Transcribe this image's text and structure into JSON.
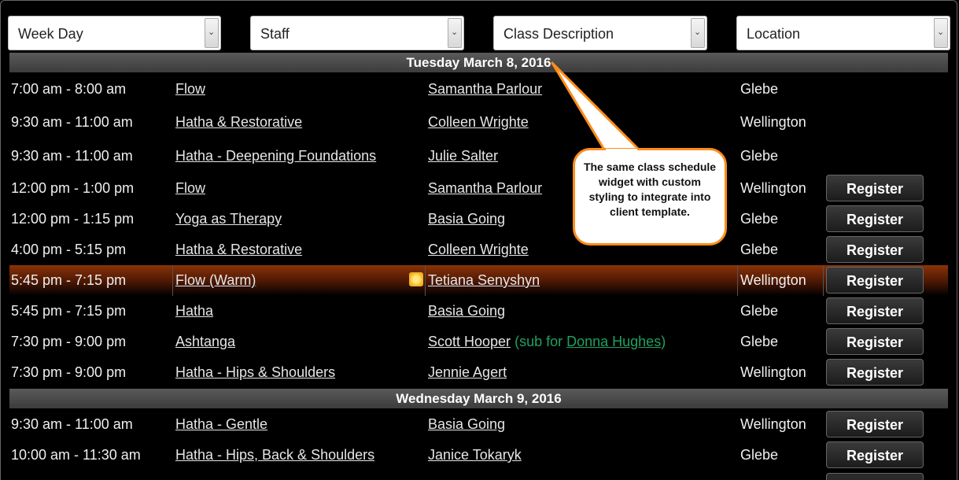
{
  "filters": {
    "weekday": "Week Day",
    "staff": "Staff",
    "class_description": "Class Description",
    "location": "Location"
  },
  "days": [
    {
      "header": "Tuesday March 8, 2016",
      "rows": [
        {
          "time": "7:00 am - 8:00 am",
          "class": "Flow",
          "instructor": "Samantha Parlour",
          "location": "Glebe",
          "register": ""
        },
        {
          "time": "9:30 am - 11:00 am",
          "class": "Hatha & Restorative",
          "instructor": "Colleen Wrighte",
          "location": "Wellington",
          "register": ""
        },
        {
          "time": "9:30 am - 11:00 am",
          "class": "Hatha - Deepening Foundations",
          "instructor": "Julie Salter",
          "location": "Glebe",
          "register": ""
        },
        {
          "time": "12:00 pm - 1:00 pm",
          "class": "Flow",
          "instructor": "Samantha Parlour",
          "location": "Wellington",
          "register": "Register"
        },
        {
          "time": "12:00 pm - 1:15 pm",
          "class": "Yoga as Therapy",
          "instructor": "Basia Going",
          "location": "Glebe",
          "register": "Register"
        },
        {
          "time": "4:00 pm - 5:15 pm",
          "class": "Hatha & Restorative",
          "instructor": "Colleen Wrighte",
          "location": "Glebe",
          "register": "Register"
        },
        {
          "time": "5:45 pm - 7:15 pm",
          "class": "Flow (Warm)",
          "instructor": "Tetiana Senyshyn",
          "location": "Wellington",
          "register": "Register",
          "highlight": true
        },
        {
          "time": "5:45 pm - 7:15 pm",
          "class": "Hatha",
          "instructor": "Basia Going",
          "location": "Glebe",
          "register": "Register"
        },
        {
          "time": "7:30 pm - 9:00 pm",
          "class": "Ashtanga",
          "instructor": "Scott Hooper",
          "sub_prefix": "(sub for ",
          "sub_name": "Donna Hughes",
          "sub_suffix": ")",
          "location": "Glebe",
          "register": "Register"
        },
        {
          "time": "7:30 pm - 9:00 pm",
          "class": "Hatha - Hips & Shoulders",
          "instructor": "Jennie Agert",
          "location": "Wellington",
          "register": "Register"
        }
      ]
    },
    {
      "header": "Wednesday March 9, 2016",
      "rows": [
        {
          "time": "9:30 am - 11:00 am",
          "class": "Hatha - Gentle",
          "instructor": "Basia Going",
          "location": "Wellington",
          "register": "Register"
        },
        {
          "time": "10:00 am - 11:30 am",
          "class": "Hatha - Hips, Back & Shoulders",
          "instructor": "Janice Tokaryk",
          "location": "Glebe",
          "register": "Register"
        }
      ]
    }
  ],
  "callout": {
    "text": "The same class schedule widget with custom styling to integrate into client template."
  },
  "colors": {
    "callout_border": "#ff8c1a",
    "sub_text": "#20a060",
    "highlight_row": "#8a3208"
  }
}
